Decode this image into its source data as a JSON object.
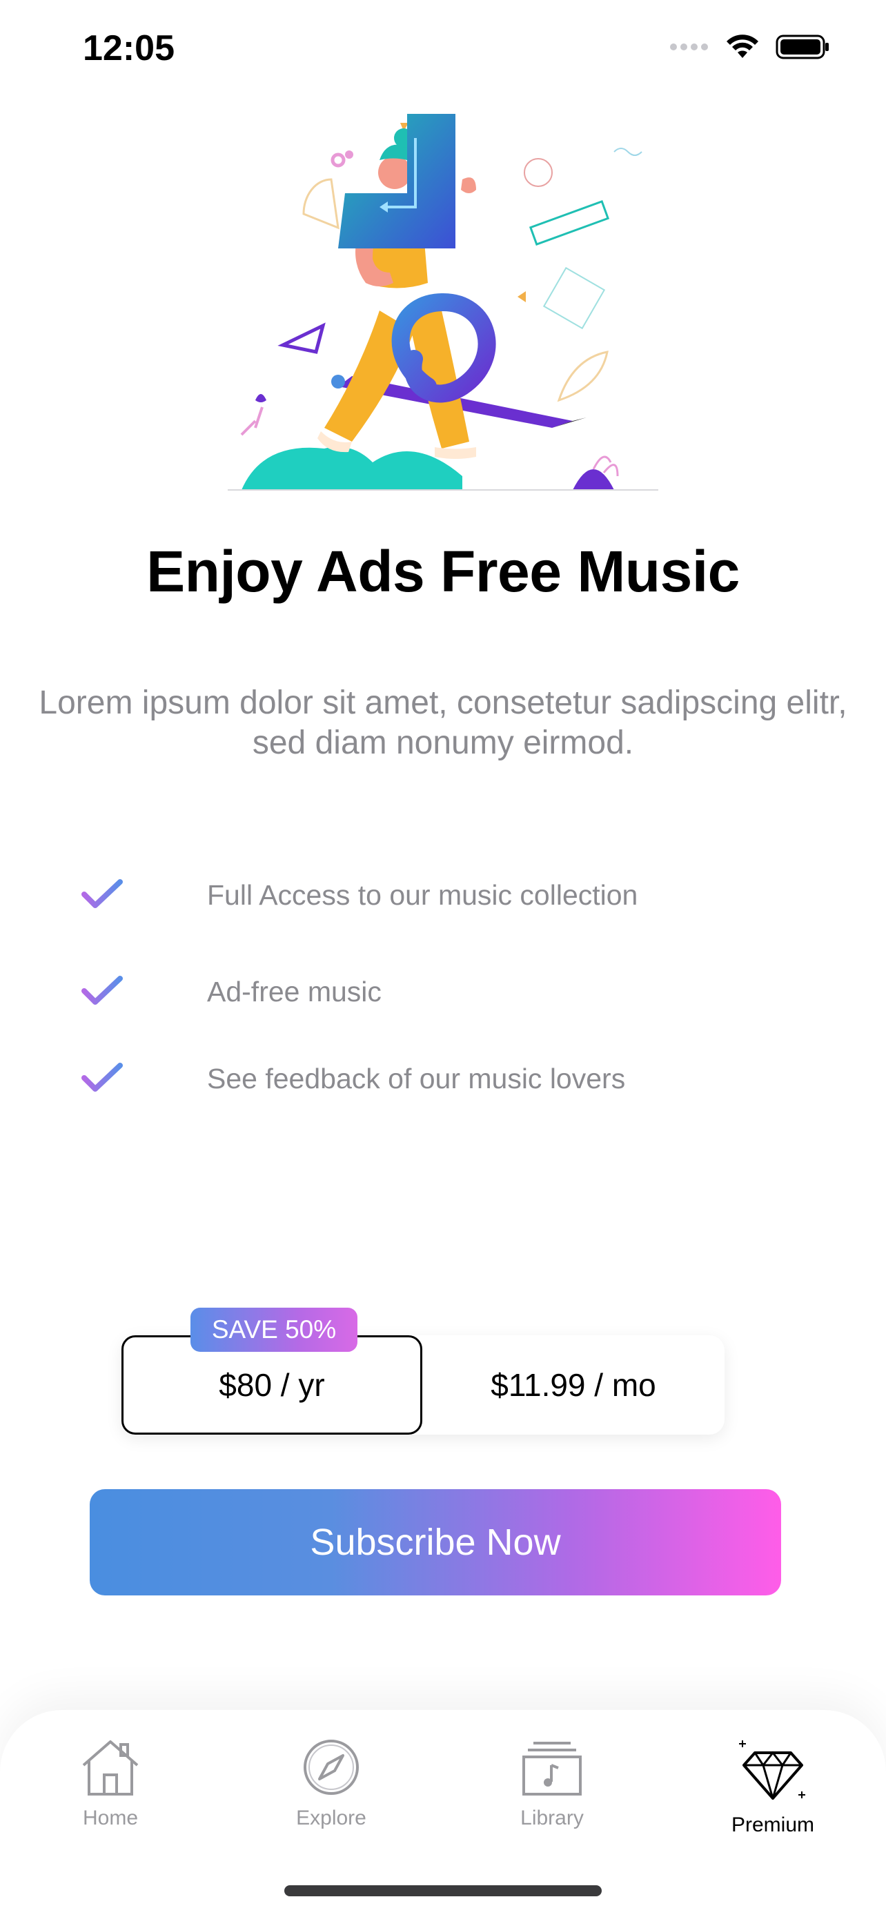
{
  "status_bar": {
    "time": "12:05"
  },
  "hero": {
    "title": "Enjoy Ads Free Music",
    "subtitle": "Lorem ipsum dolor sit amet, consetetur sadipscing elitr, sed diam nonumy eirmod."
  },
  "features": [
    {
      "text": "Full Access to our music collection"
    },
    {
      "text": "Ad-free music"
    },
    {
      "text": "See feedback of our music lovers"
    }
  ],
  "plans": {
    "badge": "SAVE 50%",
    "yearly": "$80 / yr",
    "monthly": "$11.99 / mo",
    "selected": "yearly"
  },
  "cta": {
    "label": "Subscribe Now"
  },
  "tabbar": {
    "items": [
      {
        "label": "Home",
        "icon": "home-icon"
      },
      {
        "label": "Explore",
        "icon": "compass-icon"
      },
      {
        "label": "Library",
        "icon": "library-icon"
      },
      {
        "label": "Premium",
        "icon": "diamond-icon"
      }
    ],
    "active": "Premium"
  },
  "colors": {
    "gradient_start": "#4a8ee0",
    "gradient_end": "#ff5de8",
    "check_gradient_start": "#b26ae6",
    "check_gradient_end": "#5a8ee8"
  }
}
